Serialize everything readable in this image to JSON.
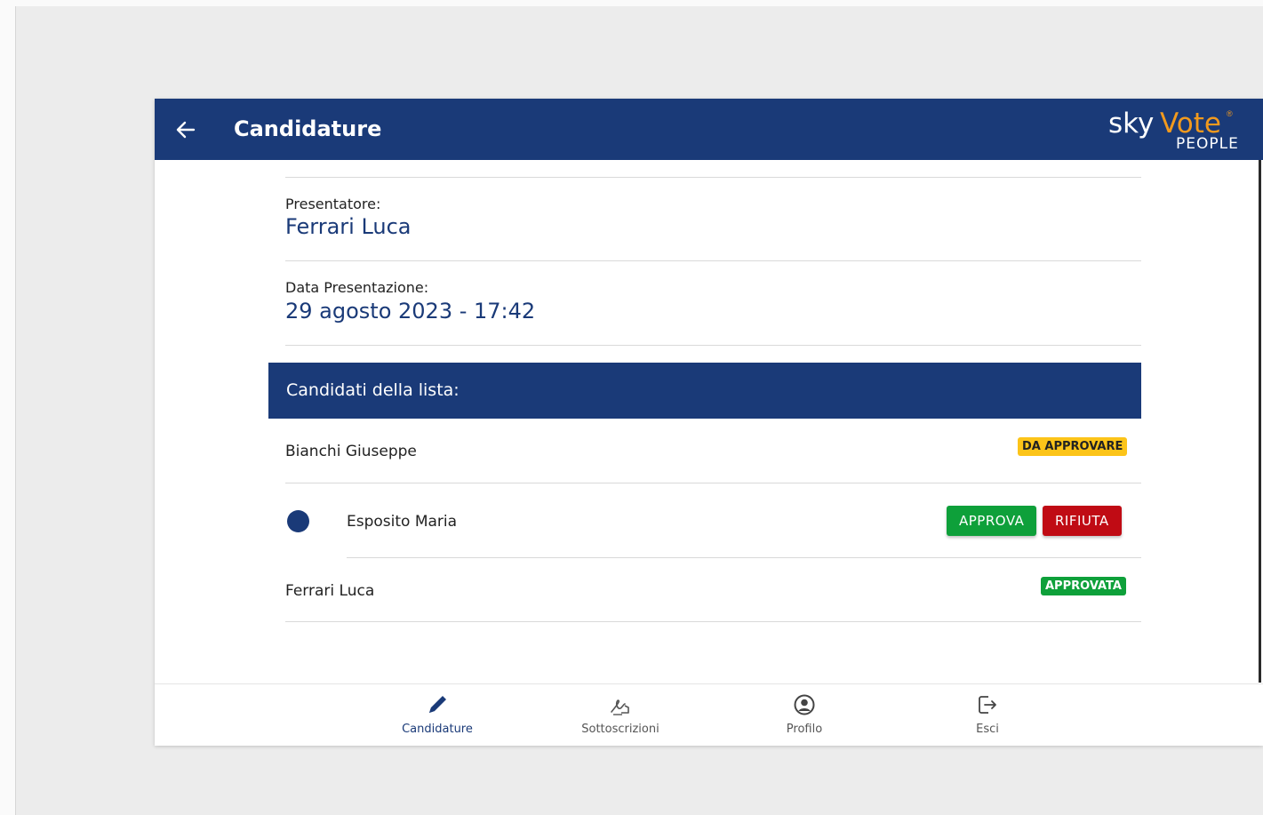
{
  "header": {
    "title": "Candidature",
    "logo": {
      "sky": "sky",
      "vote": "Vote",
      "reg": "®",
      "people": "PEOPLE"
    }
  },
  "details": {
    "presenter_label": "Presentatore:",
    "presenter_value": "Ferrari Luca",
    "date_label": "Data Presentazione:",
    "date_value": "29 agosto 2023 - 17:42"
  },
  "candidates": {
    "header": "Candidati della lista:",
    "items": [
      {
        "name": "Bianchi Giuseppe",
        "status": "DA APPROVARE"
      },
      {
        "name": "Esposito Maria",
        "approve_label": "APPROVA",
        "reject_label": "RIFIUTA"
      },
      {
        "name": "Ferrari Luca",
        "status": "APPROVATA"
      }
    ]
  },
  "nav": {
    "items": [
      {
        "label": "Candidature",
        "icon": "pencil-icon",
        "active": true
      },
      {
        "label": "Sottoscrizioni",
        "icon": "signature-icon"
      },
      {
        "label": "Profilo",
        "icon": "profile-icon"
      },
      {
        "label": "Esci",
        "icon": "logout-icon"
      }
    ]
  },
  "colors": {
    "primary": "#1a3a78",
    "accent": "#f29a1e",
    "approve": "#0ea03a",
    "reject": "#c00b14",
    "pending": "#fcc419"
  }
}
